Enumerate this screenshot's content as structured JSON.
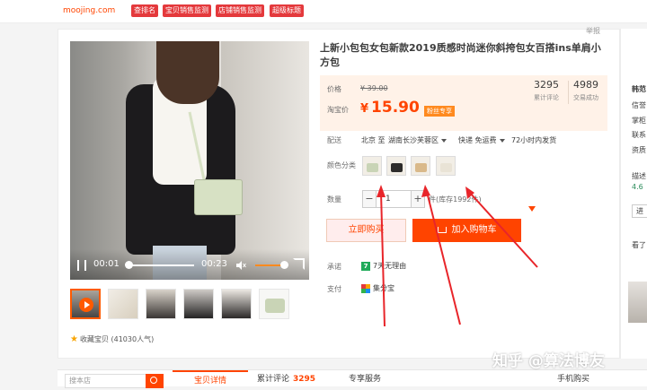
{
  "header": {
    "logo_text": "moojing.com",
    "tags": [
      "查排名",
      "宝贝销售监测",
      "店铺销售监测",
      "超级标题"
    ]
  },
  "product": {
    "title": "上新小包包女包新款2019质感时尚迷你斜挎包女百搭ins单肩小方包",
    "report": "举报",
    "price_label": "价格",
    "old_price": "¥ 39.00",
    "taobao_price_label": "淘宝价",
    "currency": "¥",
    "price": "15.90",
    "fan_badge": "粉丝专享",
    "review_count": "3295",
    "review_label": "累计评论",
    "deal_count": "4989",
    "deal_label": "交易成功",
    "delivery_label": "配送",
    "delivery_from": "北京 至",
    "delivery_to": "湖南长沙芙蓉区",
    "shipping": "快递 免运费",
    "dispatch": "72小时内发货",
    "color_label": "颜色分类",
    "qty_label": "数量",
    "qty_value": "1",
    "qty_minus": "−",
    "qty_plus": "+",
    "stock": "件(库存1992件)",
    "buy_now": "立即购买",
    "add_to_cart": "加入购物车",
    "promise_label": "承诺",
    "promise_value": "7天无理由",
    "pay_label": "支付",
    "pay_value": "集分宝",
    "favorite": "收藏宝贝 (41030人气)"
  },
  "video": {
    "current_time": "00:01",
    "duration": "00:23",
    "progress": 0.04,
    "volume": 0.95
  },
  "colors": {
    "accent": "#ff4400",
    "price_bg": "#fff2e8"
  },
  "bottom": {
    "search_placeholder": "搜本店",
    "tab_detail": "宝贝详情",
    "tab_reviews": "累计评论",
    "tab_reviews_count": "3295",
    "tab_service": "专享服务",
    "mobile_buy": "手机购买"
  },
  "sidebar": {
    "shop_name": "韩范",
    "line1": "信誉",
    "line2": "掌柜",
    "line3": "联系",
    "line4": "资质",
    "line5": "描述",
    "line6": "4.6",
    "line7": "进",
    "line8": "看了"
  },
  "watermark": "知乎 @算法博友"
}
